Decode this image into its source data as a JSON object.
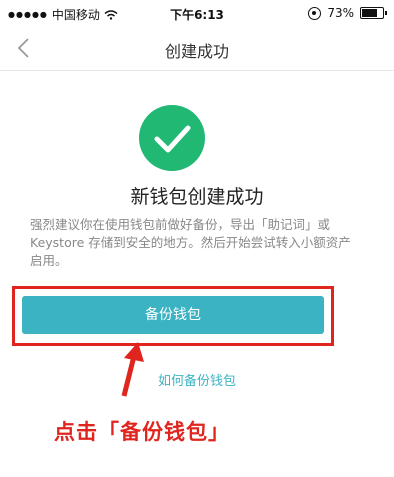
{
  "status_bar": {
    "signal_dots": "●●●●●",
    "carrier": "中国移动",
    "time": "下午6:13",
    "battery": "73%"
  },
  "nav": {
    "title": "创建成功",
    "back_icon": "chevron-left-icon"
  },
  "main": {
    "success_icon": "check-circle-icon",
    "success_color": "#21b873",
    "title": "新钱包创建成功",
    "description": "强烈建议你在使用钱包前做好备份，导出「助记词」或 Keystore 存储到安全的地方。然后开始尝试转入小额资产启用。",
    "backup_button_label": "备份钱包",
    "help_link": "如何备份钱包"
  },
  "annotation": {
    "text": "点击「备份钱包」",
    "color": "#e0251f"
  },
  "colors": {
    "accent": "#3bb3c3"
  }
}
